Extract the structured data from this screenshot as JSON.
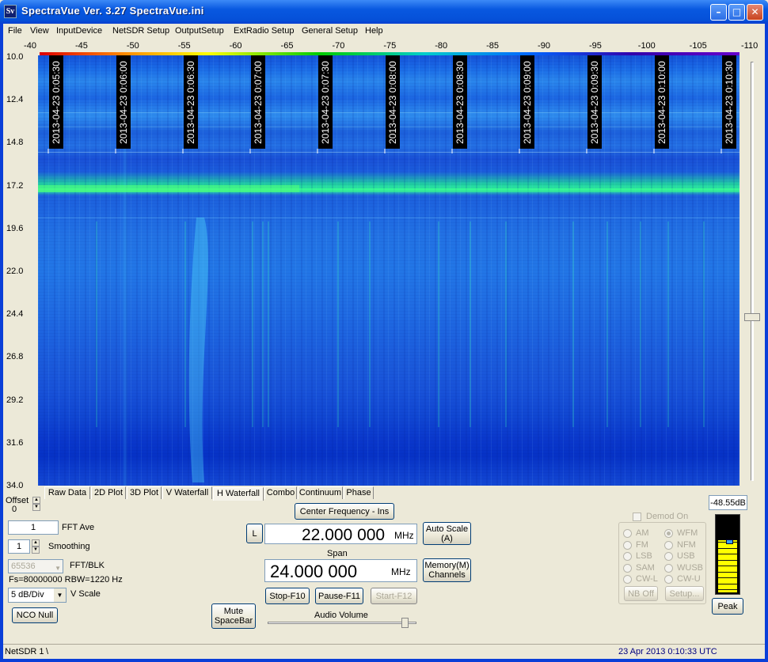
{
  "window": {
    "title": "SpectraVue Ver. 3.27  SpectraVue.ini",
    "icon_text": "Sv"
  },
  "menu": [
    "File",
    "View",
    "InputDevice",
    "NetSDR Setup",
    "OutputSetup",
    "ExtRadio Setup",
    "General Setup",
    "Help"
  ],
  "scale_ticks": [
    "-40",
    "-45",
    "-50",
    "-55",
    "-60",
    "-65",
    "-70",
    "-75",
    "-80",
    "-85",
    "-90",
    "-95",
    "-100",
    "-105",
    "-110"
  ],
  "freq_labels": [
    "10.0",
    "12.4",
    "14.8",
    "17.2",
    "19.6",
    "22.0",
    "24.4",
    "26.8",
    "29.2",
    "31.6",
    "34.0"
  ],
  "timestamps": [
    "2013-04-23 0:05:30",
    "2013-04-23 0:06:00",
    "2013-04-23 0:06:30",
    "2013-04-23 0:07:00",
    "2013-04-23 0:07:30",
    "2013-04-23 0:08:00",
    "2013-04-23 0:08:30",
    "2013-04-23 0:09:00",
    "2013-04-23 0:09:30",
    "2013-04-23 0:10:00",
    "2013-04-23 0:10:30"
  ],
  "tabs": [
    "Raw Data",
    "2D Plot",
    "3D Plot",
    "V Waterfall",
    "H Waterfall",
    "Combo",
    "Continuum",
    "Phase"
  ],
  "selected_tab": "H Waterfall",
  "controls": {
    "offset_label": "Offset",
    "offset_value": "0",
    "fft_ave_value": "1",
    "fft_ave_label": "FFT Ave",
    "smoothing_value": "1",
    "smoothing_label": "Smoothing",
    "fft_blk_value": "65536",
    "fft_blk_label": "FFT/BLK",
    "fs_text": "Fs=80000000 RBW=1220 Hz",
    "vscale_value": "5 dB/Div",
    "vscale_label": "V Scale",
    "nco_null": "NCO Null"
  },
  "center": {
    "button": "Center Frequency - Ins",
    "l_button": "L",
    "freq_value": "22.000 000",
    "freq_unit": "MHz",
    "auto_scale": "Auto Scale",
    "auto_scale_key": "(A)",
    "span_label": "Span",
    "span_value": "24.000 000",
    "span_unit": "MHz",
    "memory_line1": "Memory(M)",
    "memory_line2": "Channels",
    "stop": "Stop-F10",
    "pause": "Pause-F11",
    "start": "Start-F12",
    "mute_line1": "Mute",
    "mute_line2": "SpaceBar",
    "audio_volume": "Audio Volume"
  },
  "demod": {
    "demod_on": "Demod On",
    "left": [
      "AM",
      "FM",
      "LSB",
      "SAM",
      "CW-L"
    ],
    "right": [
      "WFM",
      "NFM",
      "USB",
      "WUSB",
      "CW-U"
    ],
    "selected": "WFM",
    "nb_off": "NB Off",
    "setup": "Setup..."
  },
  "meter": {
    "value": "-48.55dB",
    "peak": "Peak",
    "level": 0.66
  },
  "status": {
    "left": "NetSDR 1",
    "sep": "\\",
    "right": "23 Apr 2013  0:10:33 UTC"
  },
  "colors": {
    "title_blue": "#0858e0",
    "accent_blue": "#1a6ae6",
    "meter_yellow": "#ffff00",
    "status_blue": "#000080"
  }
}
